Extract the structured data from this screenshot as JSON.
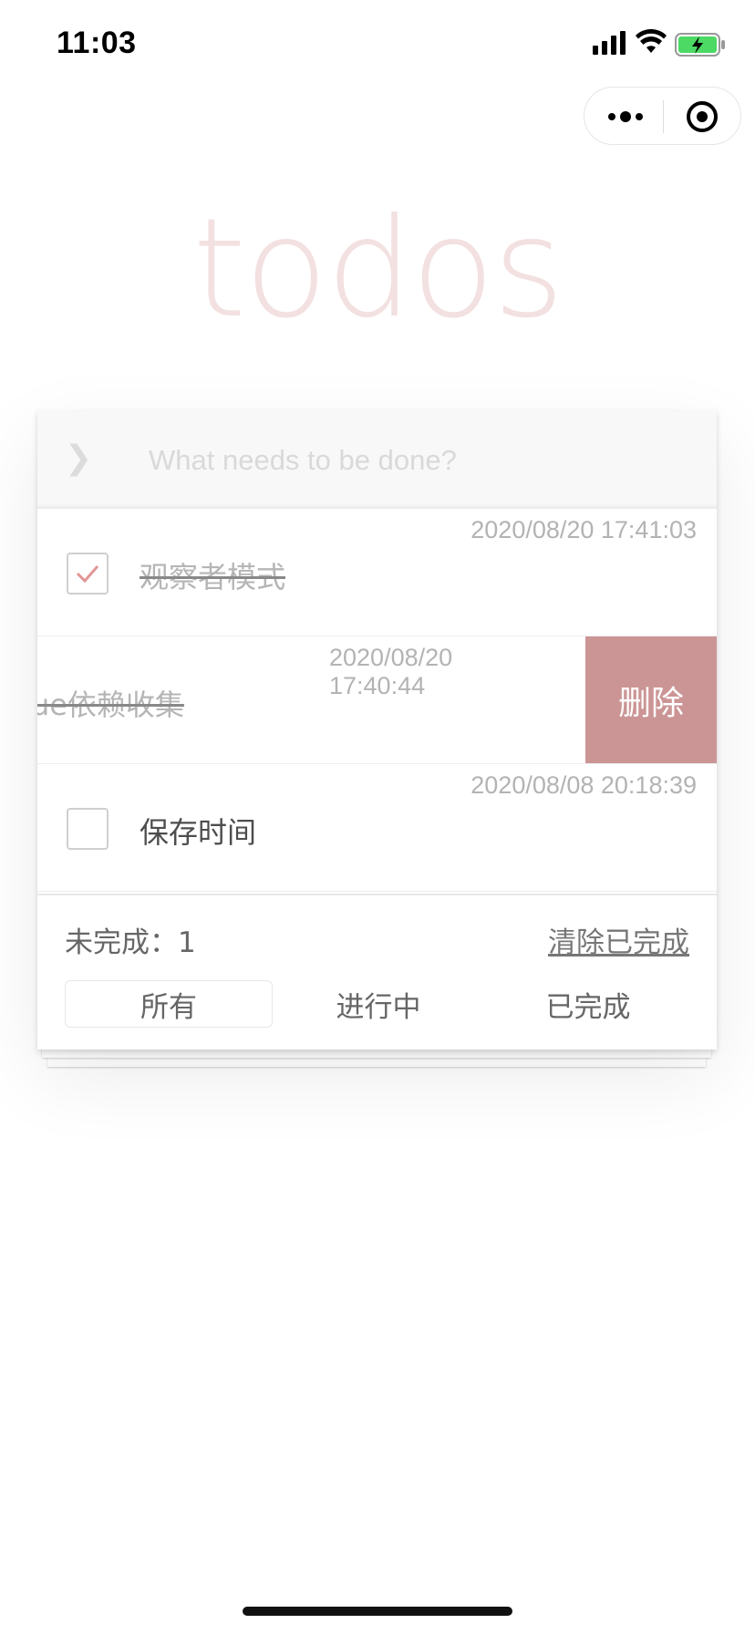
{
  "status_bar": {
    "time": "11:03"
  },
  "app": {
    "title": "todos"
  },
  "new_todo": {
    "toggle_icon": "chevron-right",
    "placeholder": "What needs to be done?"
  },
  "todos": [
    {
      "timestamp": "2020/08/20 17:41:03",
      "label": "观察者模式",
      "completed": true
    },
    {
      "timestamp": "2020/08/20 17:40:44",
      "label": "vue依赖收集",
      "completed": true,
      "swiped": true,
      "action_label": "删除"
    },
    {
      "timestamp": "2020/08/08 20:18:39",
      "label": "保存时间",
      "completed": false
    }
  ],
  "footer": {
    "remaining": "未完成：1",
    "clear_completed": "清除已完成",
    "filters": [
      "所有",
      "进行中",
      "已完成"
    ],
    "active_filter": "所有"
  },
  "colors": {
    "title": "#efdede",
    "delete": "#cc9595",
    "check": "#e29595"
  }
}
